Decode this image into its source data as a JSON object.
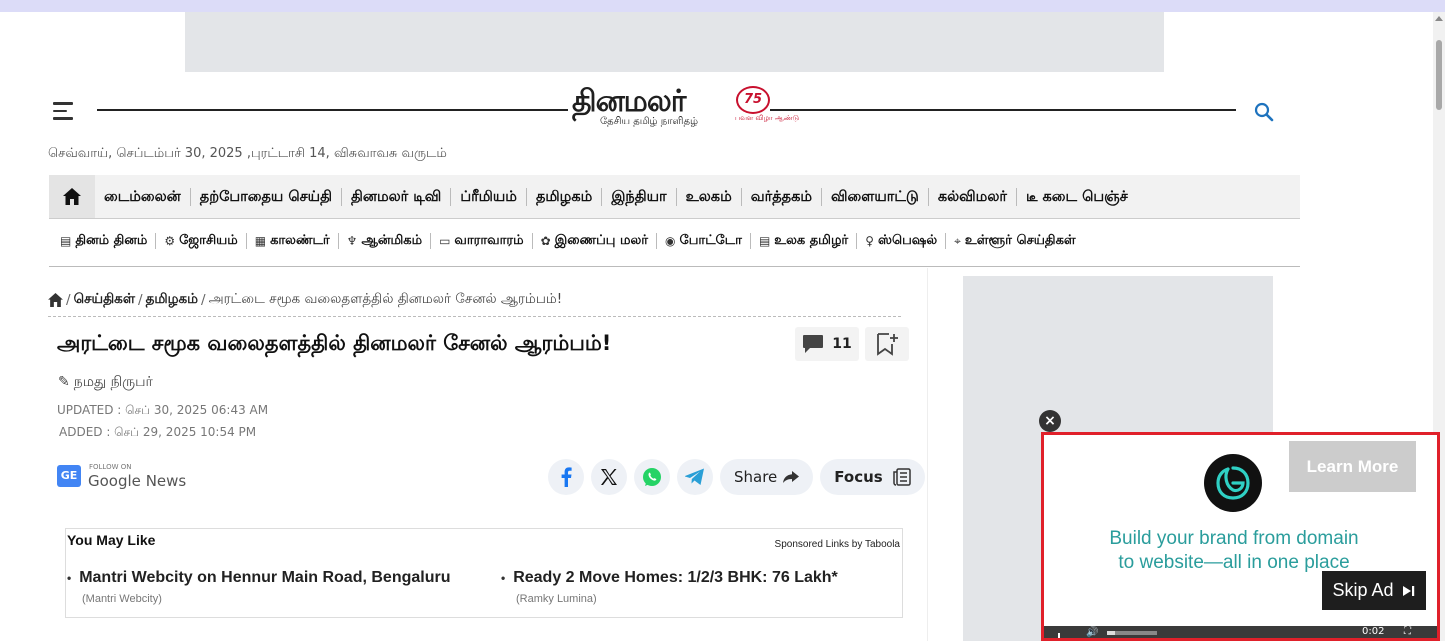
{
  "header": {
    "logo_text": "தினமலர்",
    "logo_subtitle": "தேசிய தமிழ் நாளிதழ்",
    "logo_badge": "75",
    "logo_badge_sub": "பவள விழா ஆண்டு",
    "date": "செவ்வாய், செப்டம்பர் 30, 2025 ,புரட்டாசி 14, விசுவாவசு வருடம்"
  },
  "nav_main": [
    "டைம்லைன்",
    "தற்போதைய செய்தி",
    "தினமலர் டிவி",
    "ப்ரீமியம்",
    "தமிழகம்",
    "இந்தியா",
    "உலகம்",
    "வர்த்தகம்",
    "விளையாட்டு",
    "கல்விமலர்",
    "டீ கடை பெஞ்ச்"
  ],
  "nav_secondary": [
    {
      "icon": "▤",
      "label": "தினம் தினம்"
    },
    {
      "icon": "⚙",
      "label": "ஜோசியம்"
    },
    {
      "icon": "▦",
      "label": "காலண்டர்"
    },
    {
      "icon": "♆",
      "label": "ஆன்மிகம்"
    },
    {
      "icon": "▭",
      "label": "வாராவாரம்"
    },
    {
      "icon": "✿",
      "label": "இணைப்பு மலர்"
    },
    {
      "icon": "◉",
      "label": "போட்டோ"
    },
    {
      "icon": "▤",
      "label": "உலக தமிழர்"
    },
    {
      "icon": "♀",
      "label": "ஸ்பெஷல்"
    },
    {
      "icon": "⌖",
      "label": "உள்ளூர் செய்திகள்"
    }
  ],
  "breadcrumb": {
    "sep": "/",
    "news": "செய்திகள்",
    "state": "தமிழகம்",
    "current": "அரட்டை சமூக வலைதளத்தில் தினமலர் சேனல் ஆரம்பம்!"
  },
  "article": {
    "headline": "அரட்டை சமூக வலைதளத்தில் தினமலர் சேனல் ஆரம்பம்!",
    "comment_count": "11",
    "author": "நமது நிருபர்",
    "updated": "UPDATED : செப் 30, 2025 06:43 AM",
    "added": "ADDED : செப் 29, 2025 10:54 PM"
  },
  "follow": {
    "follow_on": "FOLLOW ON",
    "google": "Google",
    "news": "News"
  },
  "share": {
    "share_label": "Share",
    "focus_label": "Focus"
  },
  "taboola": {
    "title": "You May Like",
    "sponsor": "Sponsored Links by Taboola",
    "items": [
      {
        "title": "Mantri Webcity on Hennur Main Road, Bengaluru",
        "source": "(Mantri Webcity)"
      },
      {
        "title": "Ready 2 Move Homes: 1/2/3 BHK: 76 Lakh*",
        "source": "(Ramky Lumina)"
      }
    ]
  },
  "video_ad": {
    "learn_more": "Learn More",
    "line1": "Build your brand from domain",
    "line2": "to website—all in one place",
    "skip": "Skip Ad",
    "time": "0:02",
    "progress": 0.15,
    "accent_color": "#2a9d9c"
  }
}
